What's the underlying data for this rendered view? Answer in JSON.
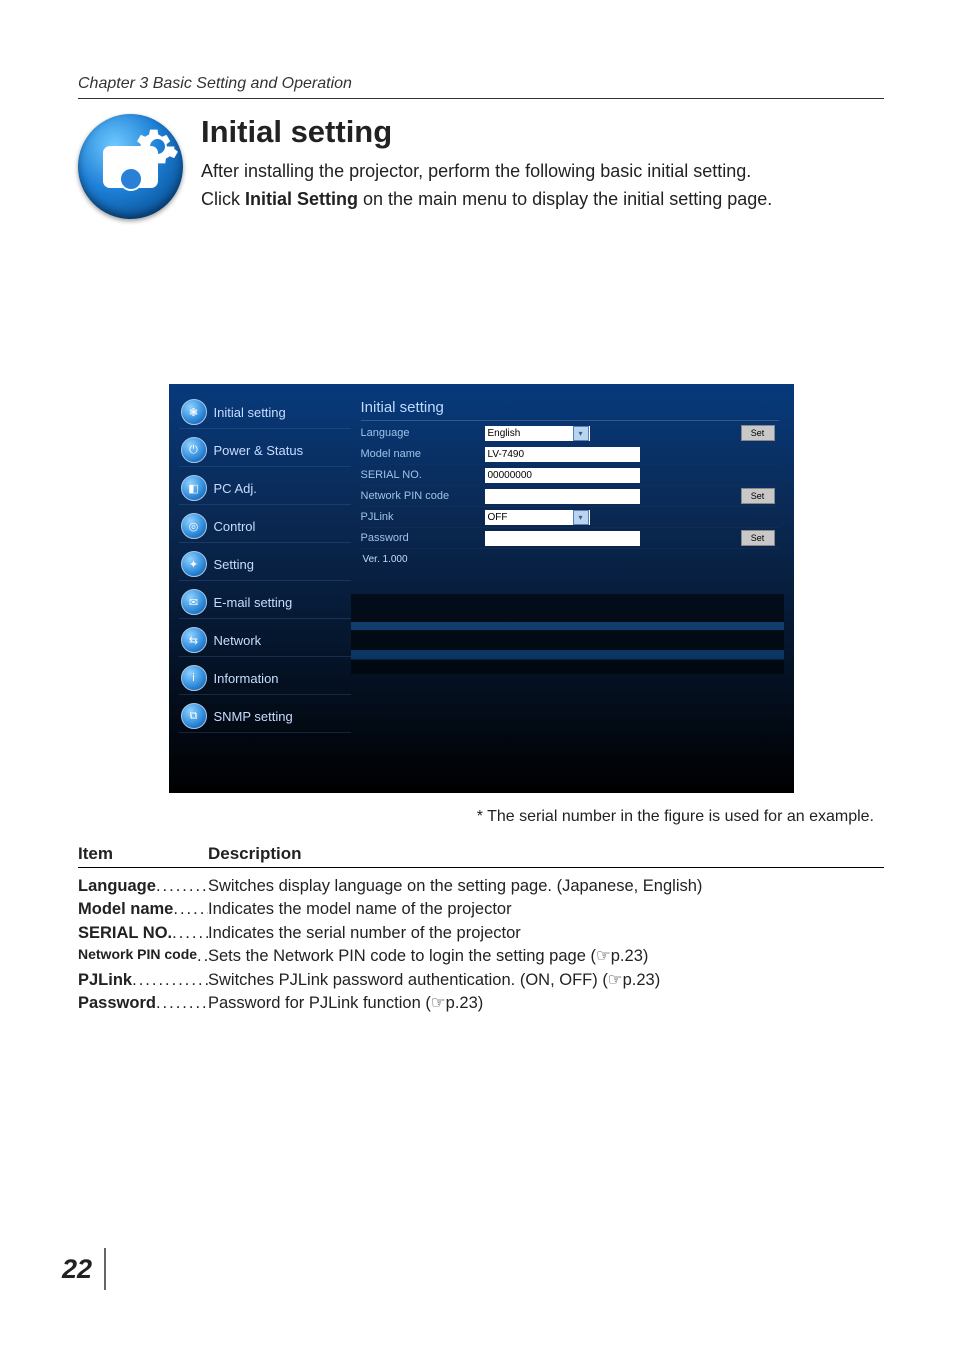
{
  "chapter": "Chapter 3 Basic Setting and Operation",
  "heading": "Initial setting",
  "intro_line1": "After installing the projector, perform the following basic initial setting.",
  "intro_line2a": "Click ",
  "intro_bold": "Initial Setting",
  "intro_line2b": " on the main menu to display the initial setting page.",
  "sidebar": {
    "items": [
      {
        "label": "Initial setting",
        "glyph": "❃"
      },
      {
        "label": "Power & Status",
        "glyph": "⏻"
      },
      {
        "label": "PC Adj.",
        "glyph": "◧"
      },
      {
        "label": "Control",
        "glyph": "◎"
      },
      {
        "label": "Setting",
        "glyph": "✦"
      },
      {
        "label": "E-mail setting",
        "glyph": "✉"
      },
      {
        "label": "Network",
        "glyph": "⇆"
      },
      {
        "label": "Information",
        "glyph": "i"
      },
      {
        "label": "SNMP setting",
        "glyph": "⧉"
      }
    ]
  },
  "panel": {
    "title": "Initial setting",
    "rows": {
      "language": {
        "label": "Language",
        "value": "English",
        "set": "Set"
      },
      "model": {
        "label": "Model name",
        "value": "LV-7490"
      },
      "serial": {
        "label": "SERIAL NO.",
        "value": "00000000"
      },
      "pin": {
        "label": "Network PIN code",
        "value": "",
        "set": "Set"
      },
      "pjlink": {
        "label": "PJLink",
        "value": "OFF"
      },
      "password": {
        "label": "Password",
        "value": "",
        "set": "Set"
      },
      "version": {
        "label": "Ver. 1.000"
      }
    }
  },
  "footnote": "* The serial number in the figure is used for an example.",
  "table": {
    "col1": "Item",
    "col2": "Description",
    "rows": [
      {
        "term": "Language",
        "desc": "Switches display language on the setting page. (Japanese, English)"
      },
      {
        "term": "Model name",
        "desc": "Indicates the model name of the projector"
      },
      {
        "term": "SERIAL NO.",
        "desc": "Indicates the serial number of the projector"
      },
      {
        "term": "Network PIN code",
        "small": true,
        "desc": "Sets the Network PIN code to login the setting page (☞p.23)"
      },
      {
        "term": "PJLink",
        "desc": "Switches PJLink password authentication. (ON, OFF) (☞p.23)"
      },
      {
        "term": "Password",
        "desc": "Password for PJLink function (☞p.23)"
      }
    ]
  },
  "page_number": "22"
}
